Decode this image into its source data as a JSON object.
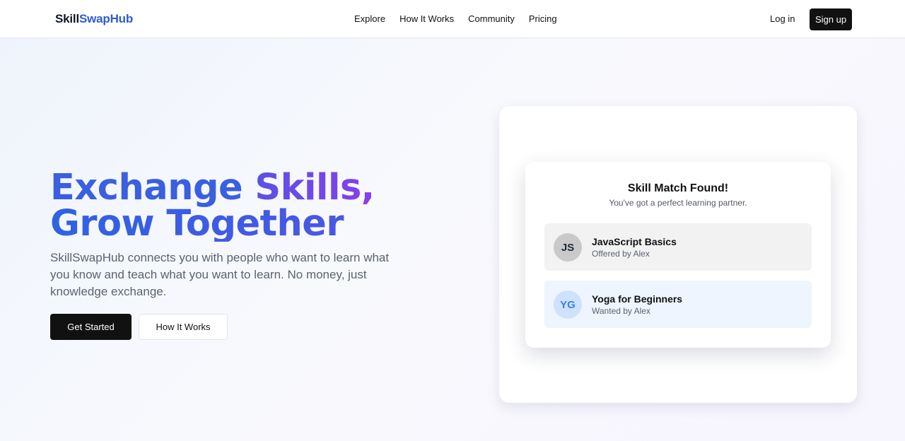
{
  "header": {
    "logo_part1": "Skill",
    "logo_part2": "SwapHub",
    "nav": [
      "Explore",
      "How It Works",
      "Community",
      "Pricing"
    ],
    "login": "Log in",
    "signup": "Sign up"
  },
  "hero": {
    "title_line1_part1": "Exchange ",
    "title_line1_part2": "Skills,",
    "title_line2": "Grow Together",
    "description": "SkillSwapHub connects you with people who want to learn what you know and teach what you want to learn. No money, just knowledge exchange.",
    "primary_button": "Get Started",
    "secondary_button": "How It Works"
  },
  "match_card": {
    "title": "Skill Match Found!",
    "subtitle": "You've got a perfect learning partner.",
    "skills": [
      {
        "initials": "JS",
        "name": "JavaScript Basics",
        "meta": "Offered by Alex"
      },
      {
        "initials": "YG",
        "name": "Yoga for Beginners",
        "meta": "Wanted by Alex"
      }
    ]
  },
  "colors": {
    "logo_accent": "#2f5bd3",
    "title_blue": "#3a5fe0",
    "title_purple": "#8a3ded",
    "button_dark": "#111111"
  }
}
